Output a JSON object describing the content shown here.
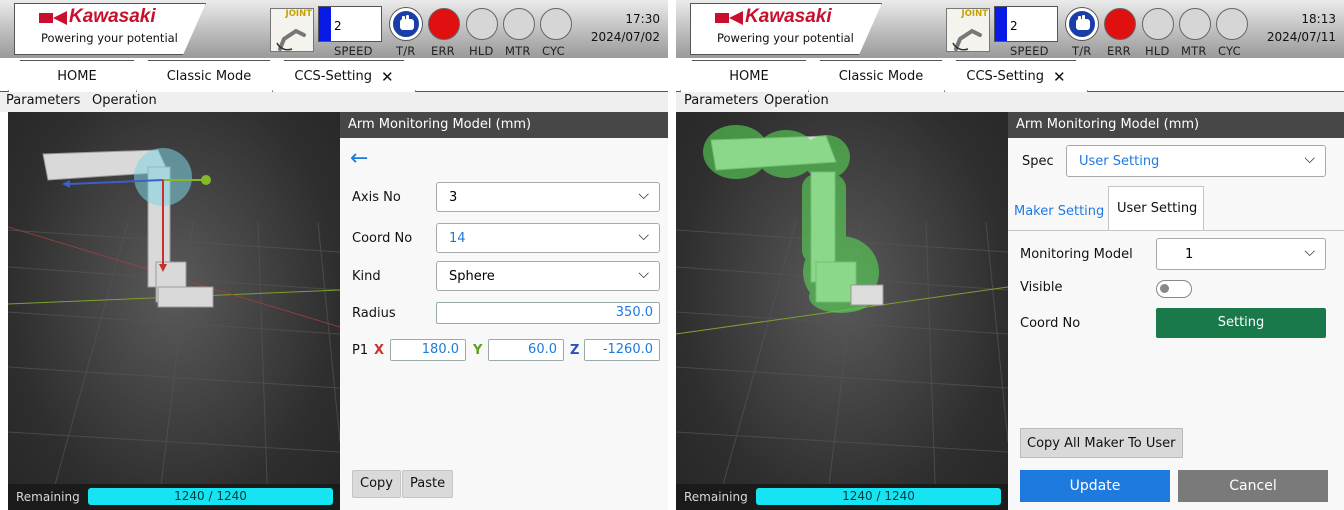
{
  "screens": [
    {
      "header": {
        "brand": "Kawasaki",
        "tagline": "Powering your potential",
        "mode_badge": "JOINT",
        "speed_value": "2",
        "labels": [
          "SPEED",
          "T/R",
          "ERR",
          "HLD",
          "MTR",
          "CYC"
        ],
        "time": "17:30",
        "date": "2024/07/02"
      },
      "tabs": {
        "home": "HOME",
        "classic": "Classic Mode",
        "ccs": "CCS-Setting",
        "close_glyph": "✕"
      },
      "menu": {
        "parameters": "Parameters",
        "operation": "Operation"
      },
      "viewport": {
        "remaining_label": "Remaining",
        "remaining_value": "1240 / 1240",
        "remaining_fraction": 1.0
      },
      "side": {
        "title": "Arm Monitoring Model (mm)",
        "back_glyph": "←",
        "axis_no_label": "Axis No",
        "axis_no_value": "3",
        "coord_no_label": "Coord No",
        "coord_no_value": "14",
        "kind_label": "Kind",
        "kind_value": "Sphere",
        "radius_label": "Radius",
        "radius_value": "350.0",
        "p1_label": "P1",
        "x_label": "X",
        "x_value": "180.0",
        "y_label": "Y",
        "y_value": "60.0",
        "z_label": "Z",
        "z_value": "-1260.0",
        "copy": "Copy",
        "paste": "Paste"
      }
    },
    {
      "header": {
        "brand": "Kawasaki",
        "tagline": "Powering your potential",
        "mode_badge": "JOINT",
        "speed_value": "2",
        "labels": [
          "SPEED",
          "T/R",
          "ERR",
          "HLD",
          "MTR",
          "CYC"
        ],
        "time": "18:13",
        "date": "2024/07/11"
      },
      "tabs": {
        "home": "HOME",
        "classic": "Classic Mode",
        "ccs": "CCS-Setting",
        "close_glyph": "✕"
      },
      "menu": {
        "parameters": "Parameters",
        "operation": "Operation"
      },
      "viewport": {
        "remaining_label": "Remaining",
        "remaining_value": "1240 / 1240",
        "remaining_fraction": 1.0
      },
      "side": {
        "title": "Arm Monitoring Model (mm)",
        "spec_label": "Spec",
        "spec_value": "User Setting",
        "tab_maker": "Maker Setting",
        "tab_user": "User Setting",
        "monitoring_model_label": "Monitoring Model",
        "monitoring_model_value": "1",
        "visible_label": "Visible",
        "coord_no_label": "Coord No",
        "setting_button": "Setting",
        "copy_all": "Copy All Maker To User",
        "update": "Update",
        "cancel": "Cancel"
      }
    }
  ],
  "colors": {
    "brand_red": "#c8102e",
    "accent_blue": "#1f7ae0",
    "green": "#19794a",
    "cyan_bar": "#16e4f2",
    "err_red": "#e01010"
  },
  "icons": [
    "robot-arm-icon",
    "teach-pendant-hand-icon",
    "chevron-down-icon",
    "back-arrow-icon",
    "close-icon"
  ]
}
